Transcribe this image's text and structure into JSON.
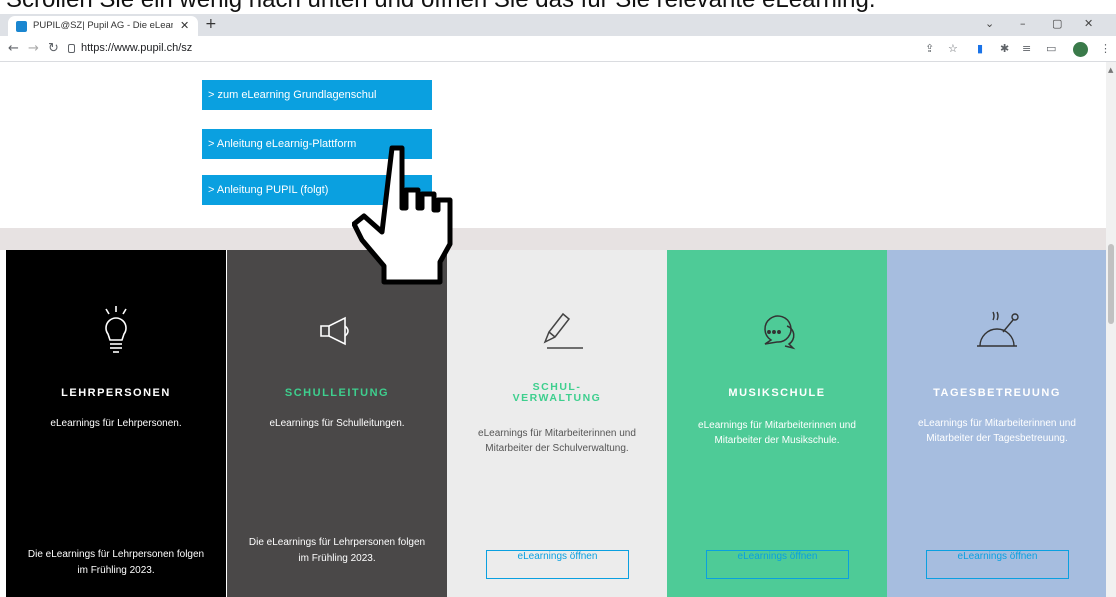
{
  "caption": "Scrollen Sie ein wenig nach unten und öffnen Sie das für Sie relevante eLearning.",
  "browser": {
    "tab_title": "PUPIL@SZ| Pupil AG - Die eLearn",
    "url": "https://www.pupil.ch/sz",
    "new_tab_icon": "plus-icon",
    "close_icon": "close-icon"
  },
  "links": [
    {
      "label": "> zum eLearning Grundlagenschul"
    },
    {
      "label": "> Anleitung eLearnig-Plattform"
    },
    {
      "label": "> Anleitung PUPIL (folgt)"
    }
  ],
  "columns": [
    {
      "heading": "LEHRPERSONEN",
      "desc": "eLearnings für Lehrpersonen.",
      "footer": "Die eLearnings für Lehrpersonen folgen im Frühling 2023.",
      "icon": "lightbulb-icon",
      "bg": "#000000",
      "heading_color": "#ffffff",
      "text_color": "#ffffff"
    },
    {
      "heading": "SCHULLEITUNG",
      "desc": "eLearnings für Schulleitungen.",
      "footer": "Die eLearnings für Lehrpersonen folgen im Frühling 2023.",
      "icon": "megaphone-icon",
      "bg": "#4a4848",
      "heading_color": "#3ecf8e",
      "text_color": "#ffffff"
    },
    {
      "heading": "SCHUL-\nVERWALTUNG",
      "desc": "eLearnings für Mitarbeiterinnen und Mitarbeiter der Schulverwaltung.",
      "button": "eLearnings öffnen",
      "icon": "pencil-icon",
      "bg": "#ececec",
      "heading_color": "#3ecf8e",
      "text_color": "#555555"
    },
    {
      "heading": "MUSIKSCHULE",
      "desc": "eLearnings für Mitarbeiterinnen und Mitarbeiter der Musikschule.",
      "button": "eLearnings öffnen",
      "icon": "chat-bubbles-icon",
      "bg": "#4ecb97",
      "heading_color": "#ffffff",
      "text_color": "#ffffff"
    },
    {
      "heading": "TAGESBETREUUNG",
      "desc": "eLearnings für Mitarbeiterinnen und Mitarbeiter der Tagesbetreuung.",
      "button": "eLearnings öffnen",
      "icon": "food-cloche-icon",
      "bg": "#a6bddf",
      "heading_color": "#ffffff",
      "text_color": "#ffffff"
    }
  ]
}
